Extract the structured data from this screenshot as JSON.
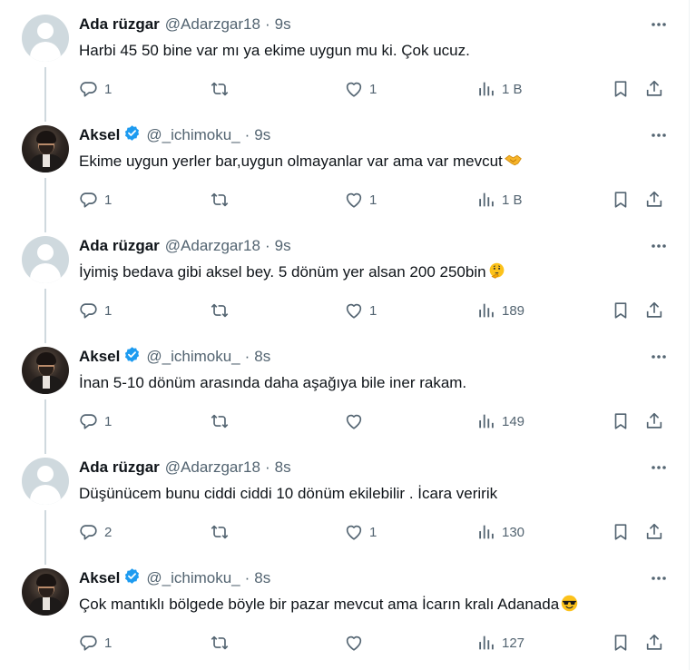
{
  "tweets": [
    {
      "name": "Ada rüzgar",
      "handle": "@Adarzgar18",
      "time": "9s",
      "text": "Harbi 45 50 bine var mı ya  ekime uygun mu ki. Çok ucuz.",
      "emoji": "",
      "replies": "1",
      "retweets": "",
      "likes": "1",
      "views": "1 B",
      "avatar": "default-avatar",
      "verified": false
    },
    {
      "name": "Aksel",
      "handle": "@_ichimoku_",
      "time": "9s",
      "text": "Ekime uygun yerler bar,uygun olmayanlar var ama var mevcut",
      "emoji": "handshake",
      "replies": "1",
      "retweets": "",
      "likes": "1",
      "views": "1 B",
      "avatar": "profile-photo",
      "verified": true
    },
    {
      "name": "Ada rüzgar",
      "handle": "@Adarzgar18",
      "time": "9s",
      "text": "İyimiş bedava gibi aksel bey. 5 dönüm yer alsan 200 250bin",
      "emoji": "thinking-face",
      "replies": "1",
      "retweets": "",
      "likes": "1",
      "views": "189",
      "avatar": "default-avatar",
      "verified": false
    },
    {
      "name": "Aksel",
      "handle": "@_ichimoku_",
      "time": "8s",
      "text": "İnan 5-10 dönüm arasında daha aşağıya bile iner rakam.",
      "emoji": "",
      "replies": "1",
      "retweets": "",
      "likes": "",
      "views": "149",
      "avatar": "profile-photo",
      "verified": true
    },
    {
      "name": "Ada rüzgar",
      "handle": "@Adarzgar18",
      "time": "8s",
      "text": "Düşünücem bunu ciddi ciddi 10 dönüm ekilebilir  . İcara veririk",
      "emoji": "",
      "replies": "2",
      "retweets": "",
      "likes": "1",
      "views": "130",
      "avatar": "default-avatar",
      "verified": false
    },
    {
      "name": "Aksel",
      "handle": "@_ichimoku_",
      "time": "8s",
      "text": "Çok mantıklı bölgede böyle bir pazar mevcut ama İcarın kralı Adanada",
      "emoji": "smiling-face-with-sunglasses",
      "replies": "1",
      "retweets": "",
      "likes": "",
      "views": "127",
      "avatar": "profile-photo",
      "verified": true
    }
  ],
  "colors": {
    "text": "#0f1419",
    "secondary": "#536471",
    "verified": "#1d9bf0",
    "thread_line": "#cfd9de",
    "default_avatar": "#cfd9de"
  }
}
